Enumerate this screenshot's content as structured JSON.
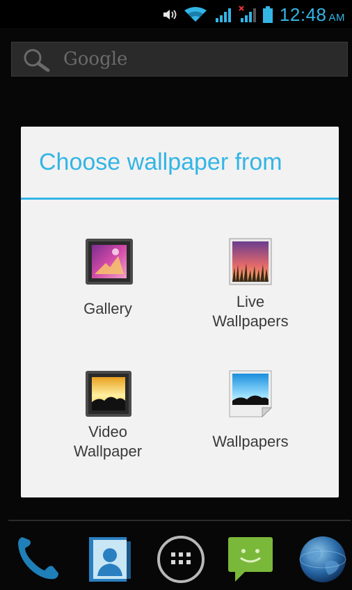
{
  "status_bar": {
    "time": "12:48",
    "ampm": "AM",
    "icons": [
      "speaker-icon",
      "wifi-icon",
      "signal-icon",
      "signal-no-sim-icon",
      "battery-icon"
    ],
    "accent_color": "#33b5e5"
  },
  "search": {
    "placeholder": "Google",
    "icon": "search-icon"
  },
  "dialog": {
    "title": "Choose wallpaper from",
    "accent_color": "#33b5e5",
    "options": [
      {
        "label": "Gallery",
        "icon": "gallery-icon"
      },
      {
        "label": "Live\nWallpapers",
        "icon": "live-wallpapers-icon"
      },
      {
        "label": "Video\nWallpaper",
        "icon": "video-wallpaper-icon"
      },
      {
        "label": "Wallpapers",
        "icon": "wallpapers-icon"
      }
    ]
  },
  "dock": {
    "items": [
      {
        "name": "phone",
        "icon": "phone-icon"
      },
      {
        "name": "contacts",
        "icon": "contacts-icon"
      },
      {
        "name": "all-apps",
        "icon": "app-drawer-icon"
      },
      {
        "name": "messaging",
        "icon": "messaging-icon"
      },
      {
        "name": "browser",
        "icon": "globe-icon"
      }
    ]
  }
}
